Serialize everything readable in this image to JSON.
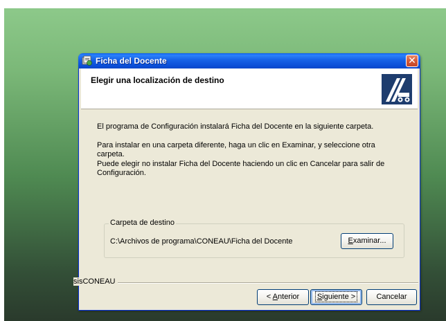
{
  "window": {
    "title": "Ficha del Docente",
    "close_glyph": "✕"
  },
  "header": {
    "title": "Elegir una localización de destino",
    "logo_icon": "installer-logo-icon"
  },
  "content": {
    "paragraphs": [
      "El programa de Configuración instalará Ficha del Docente en la siguiente carpeta.",
      "Para instalar en una carpeta diferente, haga un clic en Examinar, y seleccione otra carpeta.",
      "Puede elegir no instalar Ficha del Docente haciendo un clic en Cancelar para salir de Configuración."
    ],
    "destination": {
      "group_label": "Carpeta de destino",
      "path": "C:\\Archivos de programa\\CONEAU\\Ficha del Docente",
      "browse_label_mnemonic": "E",
      "browse_label_rest": "xaminar..."
    }
  },
  "footer": {
    "brand": "sisCONEAU",
    "back_prefix": "< ",
    "back_mnemonic": "A",
    "back_rest": "nterior",
    "next_mnemonic": "S",
    "next_rest": "iguiente >",
    "cancel_label": "Cancelar"
  },
  "colors": {
    "titlebar": "#0b4fd8",
    "window_bg": "#ece9d8",
    "button_border": "#003c74",
    "close": "#d75a36"
  }
}
